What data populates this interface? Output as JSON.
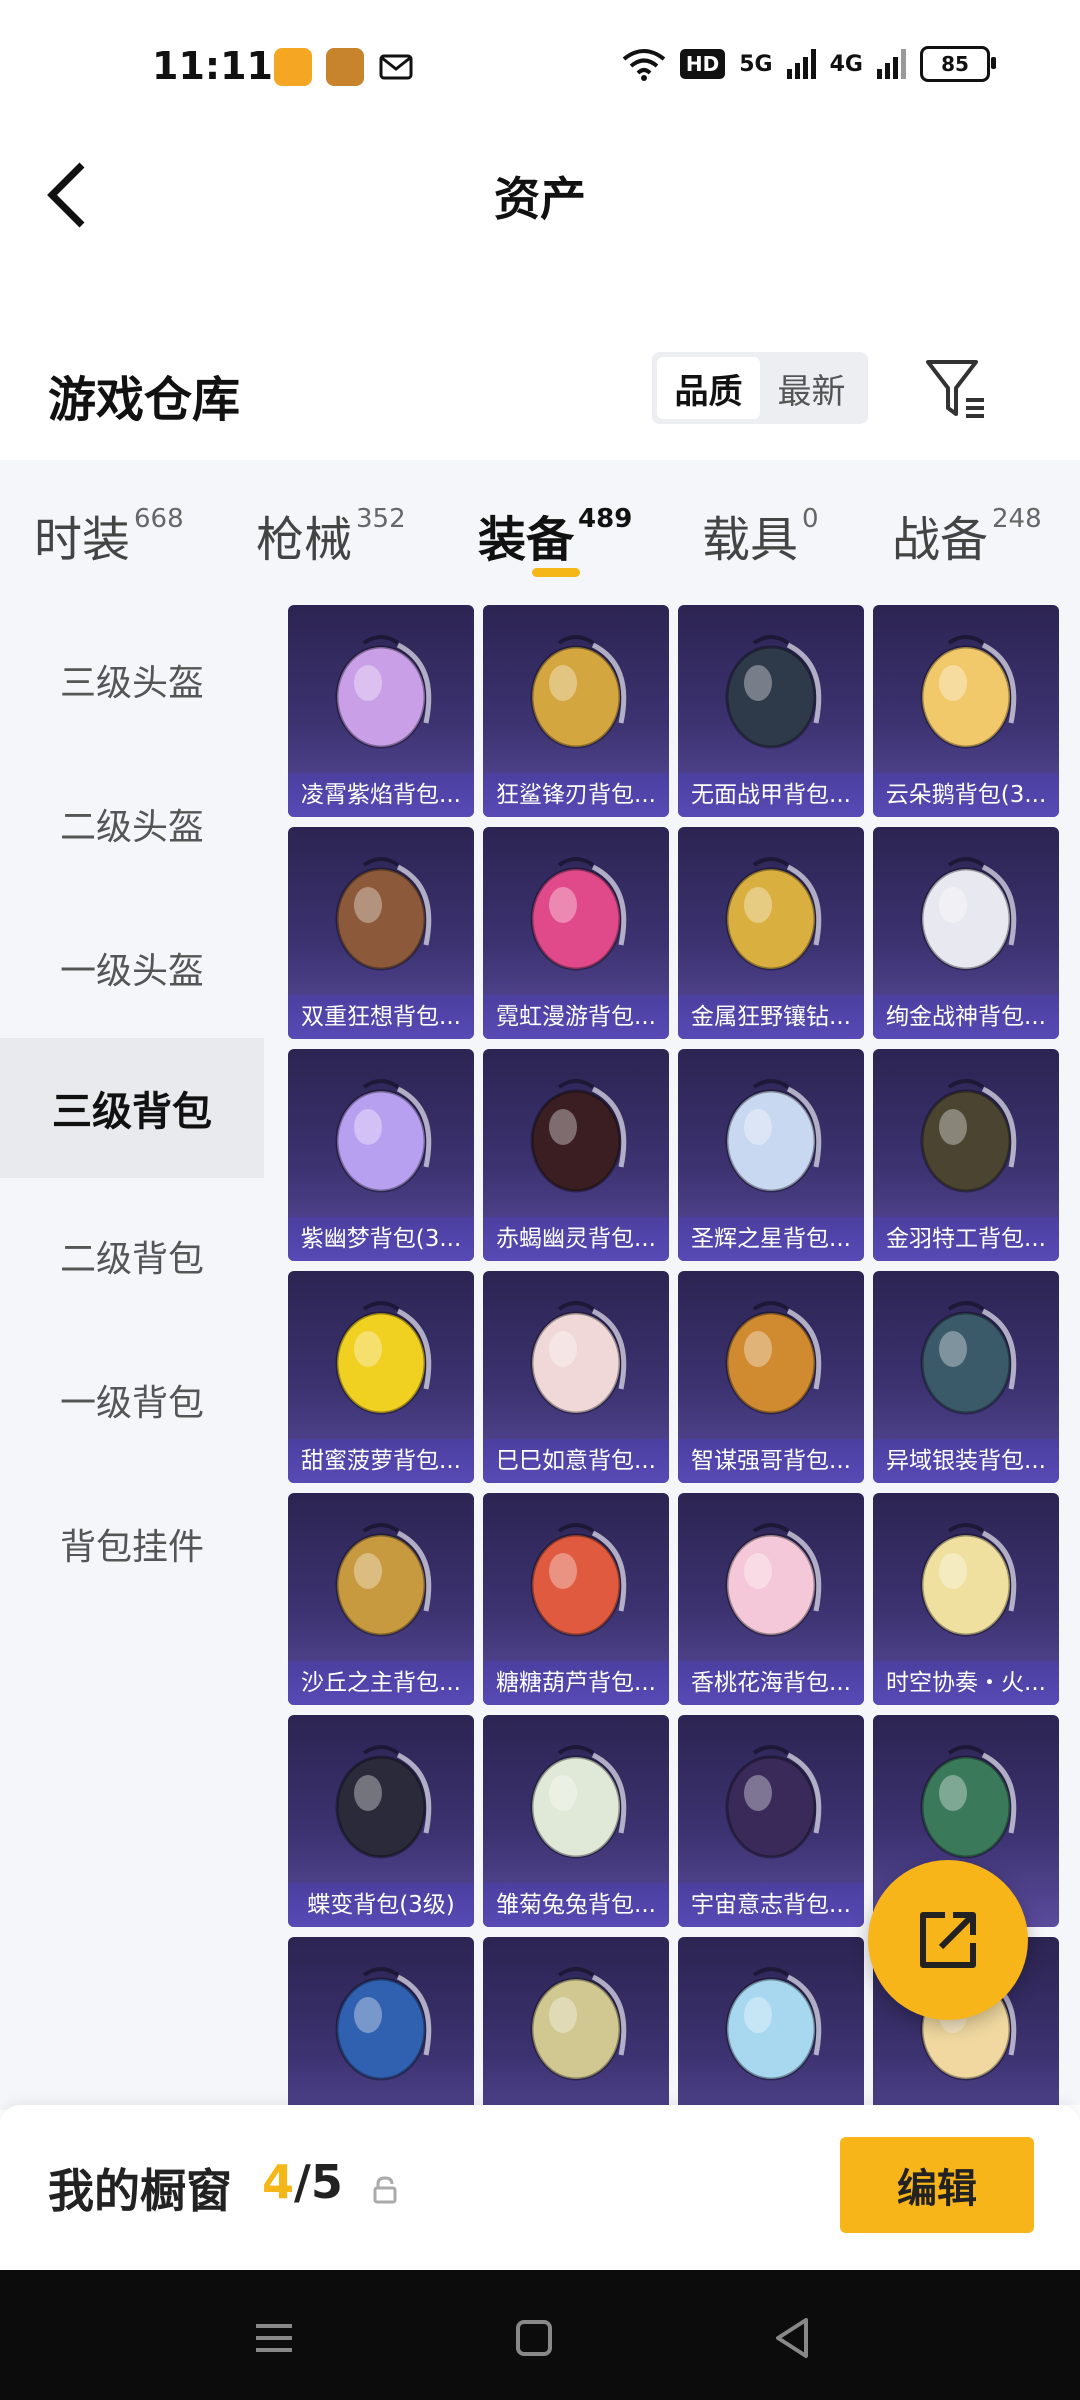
{
  "status_bar": {
    "time": "11:11",
    "hd": "HD",
    "net_5g": "5G",
    "net_4g": "4G",
    "battery": "85"
  },
  "header": {
    "title": "资产"
  },
  "warehouse": {
    "title": "游戏仓库",
    "sort_options": [
      "品质",
      "最新"
    ],
    "sort_selected": "品质"
  },
  "category_tabs": [
    {
      "label": "时装",
      "count": "668"
    },
    {
      "label": "枪械",
      "count": "352"
    },
    {
      "label": "装备",
      "count": "489",
      "active": true
    },
    {
      "label": "载具",
      "count": "0"
    },
    {
      "label": "战备",
      "count": "248"
    }
  ],
  "sidebar": {
    "items": [
      "三级头盔",
      "二级头盔",
      "一级头盔",
      "三级背包",
      "二级背包",
      "一级背包",
      "背包挂件"
    ],
    "active": "三级背包"
  },
  "items": [
    {
      "name": "凌霄紫焰背包...",
      "icon": "purple-flame-backpack"
    },
    {
      "name": "狂鲨锋刃背包...",
      "icon": "shark-blade-backpack"
    },
    {
      "name": "无面战甲背包...",
      "icon": "faceless-armor-backpack"
    },
    {
      "name": "云朵鹅背包(3...",
      "icon": "cloud-goose-backpack"
    },
    {
      "name": "双重狂想背包...",
      "icon": "double-fantasy-backpack"
    },
    {
      "name": "霓虹漫游背包...",
      "icon": "neon-roam-backpack"
    },
    {
      "name": "金属狂野镶钻...",
      "icon": "metal-wild-diamond-backpack"
    },
    {
      "name": "绚金战神背包...",
      "icon": "golden-war-god-backpack"
    },
    {
      "name": "紫幽梦背包(3...",
      "icon": "purple-dream-backpack"
    },
    {
      "name": "赤蝎幽灵背包...",
      "icon": "red-scorpion-backpack"
    },
    {
      "name": "圣辉之星背包...",
      "icon": "holy-star-backpack"
    },
    {
      "name": "金羽特工背包...",
      "icon": "golden-feather-agent-backpack"
    },
    {
      "name": "甜蜜菠萝背包...",
      "icon": "pineapple-backpack"
    },
    {
      "name": "巳巳如意背包...",
      "icon": "snake-ruyi-backpack"
    },
    {
      "name": "智谋强哥背包...",
      "icon": "strategist-backpack"
    },
    {
      "name": "异域银装背包...",
      "icon": "exotic-silver-backpack"
    },
    {
      "name": "沙丘之主背包...",
      "icon": "dune-lord-backpack"
    },
    {
      "name": "糖糖葫芦背包...",
      "icon": "candy-gourd-backpack"
    },
    {
      "name": "香桃花海背包...",
      "icon": "peach-blossom-backpack"
    },
    {
      "name": "时空协奏・火...",
      "icon": "spacetime-concerto-backpack"
    },
    {
      "name": "蝶变背包(3级)",
      "icon": "butterfly-backpack"
    },
    {
      "name": "雏菊兔兔背包...",
      "icon": "daisy-bunny-backpack"
    },
    {
      "name": "宇宙意志背包...",
      "icon": "cosmic-will-backpack"
    },
    {
      "name": "",
      "icon": "green-mech-backpack"
    },
    {
      "name": "",
      "icon": "blue-robot-backpack"
    },
    {
      "name": "",
      "icon": "ornate-ring-backpack"
    },
    {
      "name": "",
      "icon": "blue-creature-backpack"
    },
    {
      "name": "",
      "icon": "cupcake-backpack"
    }
  ],
  "showcase": {
    "label": "我的橱窗",
    "current": "4",
    "separator": "/",
    "max": "5",
    "edit_label": "编辑"
  },
  "colors": {
    "accent": "#f7b51a",
    "card_bg": "#3c3270",
    "card_label_bg": "#574ab5",
    "panel_bg": "#f5f6fa"
  }
}
